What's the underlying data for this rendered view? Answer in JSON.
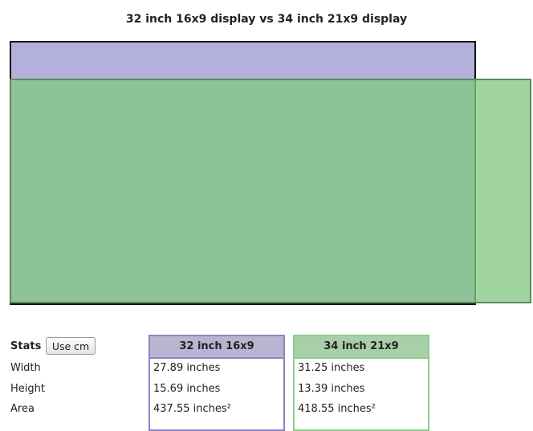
{
  "title": "32 inch 16x9 display vs 34 inch 21x9 display",
  "colors": {
    "display_a_fill": "#b3b1dc",
    "display_a_border": "#111111",
    "display_b_fill": "#84c884",
    "display_b_border": "#5c8a5c"
  },
  "stats": {
    "label": "Stats",
    "toggle_button": "Use cm",
    "rows": [
      "Width",
      "Height",
      "Area"
    ]
  },
  "displays": [
    {
      "name": "32 inch 16x9",
      "width": "27.89 inches",
      "height": "15.69 inches",
      "area": "437.55 inches²"
    },
    {
      "name": "34 inch 21x9",
      "width": "31.25 inches",
      "height": "13.39 inches",
      "area": "418.55 inches²"
    }
  ]
}
